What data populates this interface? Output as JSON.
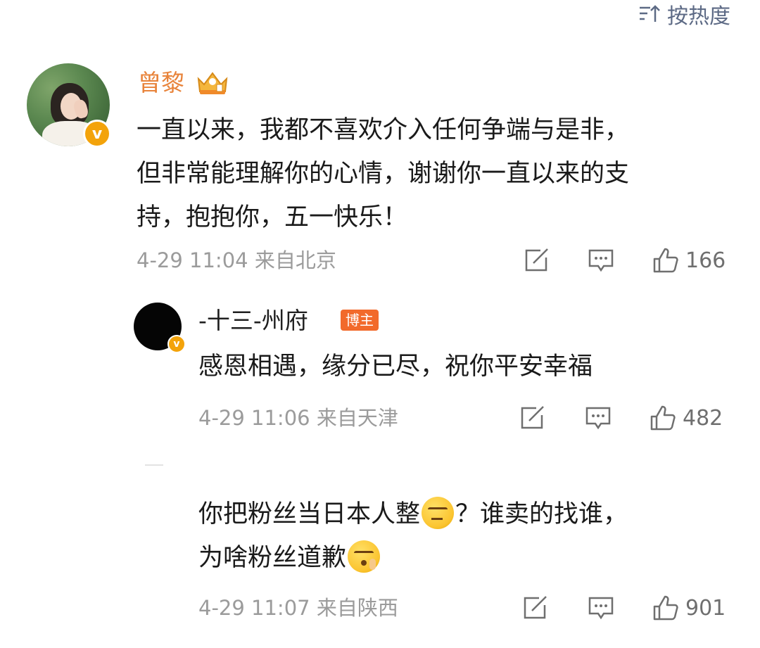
{
  "sort": {
    "label": "按热度",
    "icon": "sort-icon"
  },
  "comments": [
    {
      "user": "曾黎",
      "verified": true,
      "badge_icon": "crown-badge-icon",
      "lines": [
        "一直以来，我都不喜欢介入任何争端与是非，",
        "但非常能理解你的心情，谢谢你一直以来的支",
        "持，抱抱你，五一快乐！"
      ],
      "meta": "4-29 11:04 来自北京",
      "likes": "166"
    },
    {
      "user": "-十三-州府",
      "verified": true,
      "tag": "博主",
      "lines": [
        "感恩相遇，缘分已尽，祝你平安幸福"
      ],
      "meta": "4-29 11:06 来自天津",
      "likes": "482"
    },
    {
      "user": "",
      "line1_a": "你把粉丝当日本人整",
      "line1_b": "？谁卖的找谁，",
      "line2": "为啥粉丝道歉",
      "meta": "4-29 11:07 来自陕西",
      "likes": "901"
    }
  ],
  "colors": {
    "name_orange": "#e8833a",
    "meta_gray": "#9b9b9b",
    "host_tag": "#f26a2b",
    "verify_badge": "#f3a30b",
    "sort_blue": "#5d6a85"
  }
}
